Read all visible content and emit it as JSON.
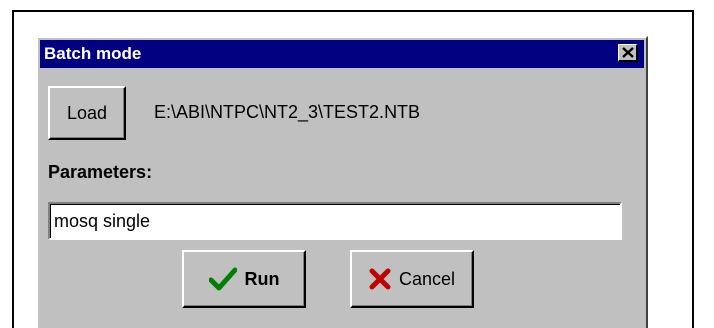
{
  "dialog": {
    "title": "Batch mode",
    "close_icon": "close-icon"
  },
  "load": {
    "label": "Load",
    "path": "E:\\ABI\\NTPC\\NT2_3\\TEST2.NTB"
  },
  "parameters": {
    "label": "Parameters:",
    "value": "mosq single"
  },
  "buttons": {
    "run_label": "Run",
    "run_icon": "checkmark-icon",
    "cancel_label": "Cancel",
    "cancel_icon": "x-icon"
  },
  "colors": {
    "titlebar": "#000080",
    "dialog_bg": "#c0c0c0",
    "check_green": "#008000",
    "cancel_red": "#c00000"
  }
}
